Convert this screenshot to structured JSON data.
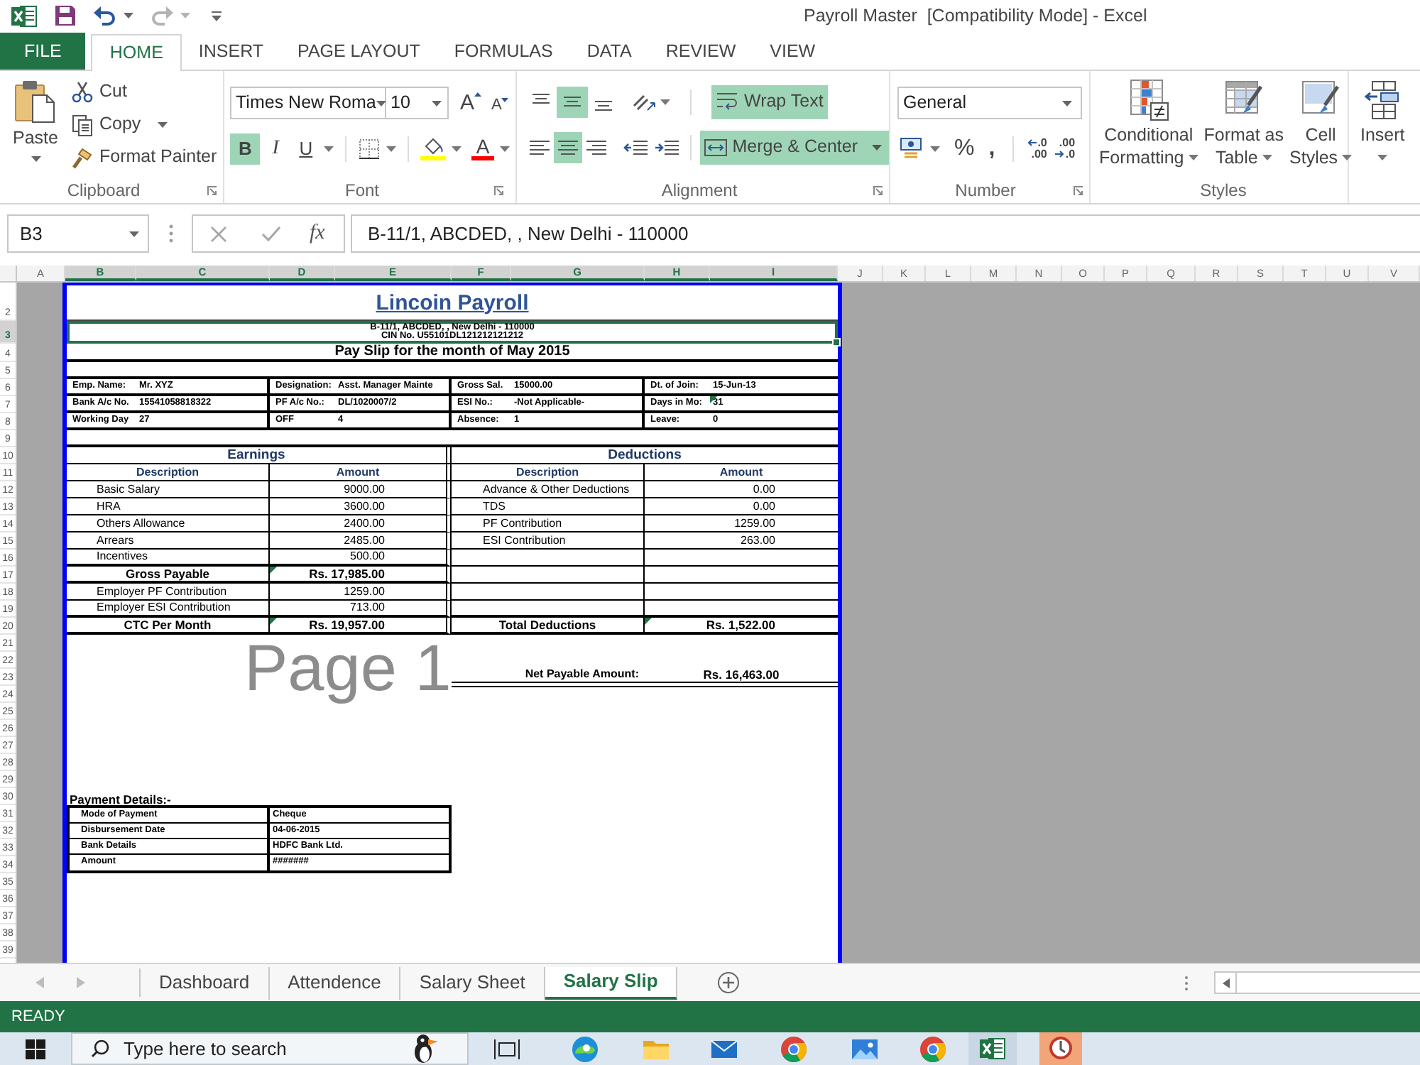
{
  "title_bar": {
    "title": "Payroll Master  [Compatibility Mode] - Excel"
  },
  "ribbon_tabs": [
    {
      "label": "FILE",
      "kind": "file",
      "selected": false
    },
    {
      "label": "HOME",
      "kind": "tab",
      "selected": true
    },
    {
      "label": "INSERT",
      "kind": "tab",
      "selected": false
    },
    {
      "label": "PAGE LAYOUT",
      "kind": "tab",
      "selected": false
    },
    {
      "label": "FORMULAS",
      "kind": "tab",
      "selected": false
    },
    {
      "label": "DATA",
      "kind": "tab",
      "selected": false
    },
    {
      "label": "REVIEW",
      "kind": "tab",
      "selected": false
    },
    {
      "label": "VIEW",
      "kind": "tab",
      "selected": false
    }
  ],
  "clipboard": {
    "paste": "Paste",
    "cut": "Cut",
    "copy": "Copy",
    "format_painter": "Format Painter",
    "group_label": "Clipboard"
  },
  "font": {
    "font_name": "Times New Roma",
    "font_size": "10",
    "grow_font": "A",
    "shrink_font": "A",
    "style_buttons": [
      {
        "label": "B",
        "on": true
      },
      {
        "label": "I",
        "on": false
      },
      {
        "label": "U",
        "on": false
      }
    ],
    "font_color": "A",
    "group_label": "Font"
  },
  "alignment": {
    "vertical": [
      {
        "kind": "top",
        "on": false
      },
      {
        "kind": "middle",
        "on": true
      },
      {
        "kind": "bottom",
        "on": false
      }
    ],
    "horizontal": [
      {
        "kind": "left",
        "on": false
      },
      {
        "kind": "center",
        "on": true
      },
      {
        "kind": "right",
        "on": false
      }
    ],
    "wrap_text": {
      "label": "Wrap Text",
      "on": true
    },
    "merge_center": {
      "label": "Merge & Center",
      "on": true
    },
    "group_label": "Alignment"
  },
  "number": {
    "format": "General",
    "percent": "%",
    "comma": ",",
    "decimal_buttons": [
      {
        "kind": "increase",
        "lines": [
          ".0",
          ".00"
        ]
      },
      {
        "kind": "decrease",
        "lines": [
          ".00",
          ".0"
        ]
      }
    ],
    "group_label": "Number"
  },
  "styles": {
    "buttons": [
      {
        "kind": "conditional",
        "lines": [
          "Conditional",
          "Formatting"
        ]
      },
      {
        "kind": "table",
        "lines": [
          "Format as",
          "Table"
        ]
      },
      {
        "kind": "cell",
        "lines": [
          "Cell",
          "Styles"
        ]
      }
    ],
    "group_label": "Styles"
  },
  "cells": {
    "insert": "Insert"
  },
  "formula_bar": {
    "name_box": "B3",
    "fx": "fx",
    "formula": "B-11/1, ABCDED, , New Delhi - 110000"
  },
  "columns": [
    {
      "label": "A",
      "selected": false
    },
    {
      "label": "B",
      "selected": true
    },
    {
      "label": "C",
      "selected": true
    },
    {
      "label": "D",
      "selected": true
    },
    {
      "label": "E",
      "selected": true
    },
    {
      "label": "F",
      "selected": true
    },
    {
      "label": "G",
      "selected": true
    },
    {
      "label": "H",
      "selected": true
    },
    {
      "label": "I",
      "selected": true
    },
    {
      "label": "J",
      "selected": false
    },
    {
      "label": "K",
      "selected": false
    },
    {
      "label": "L",
      "selected": false
    },
    {
      "label": "M",
      "selected": false
    },
    {
      "label": "N",
      "selected": false
    },
    {
      "label": "O",
      "selected": false
    },
    {
      "label": "P",
      "selected": false
    },
    {
      "label": "Q",
      "selected": false
    },
    {
      "label": "R",
      "selected": false
    },
    {
      "label": "S",
      "selected": false
    },
    {
      "label": "T",
      "selected": false
    },
    {
      "label": "U",
      "selected": false
    },
    {
      "label": "V",
      "selected": false
    }
  ],
  "rows": [
    {
      "label": "2",
      "selected": false
    },
    {
      "label": "3",
      "selected": true
    },
    {
      "label": "4",
      "selected": false
    },
    {
      "label": "5",
      "selected": false
    },
    {
      "label": "6",
      "selected": false
    },
    {
      "label": "7",
      "selected": false
    },
    {
      "label": "8",
      "selected": false
    },
    {
      "label": "9",
      "selected": false
    },
    {
      "label": "10",
      "selected": false
    },
    {
      "label": "11",
      "selected": false
    },
    {
      "label": "12",
      "selected": false
    },
    {
      "label": "13",
      "selected": false
    },
    {
      "label": "14",
      "selected": false
    },
    {
      "label": "15",
      "selected": false
    },
    {
      "label": "16",
      "selected": false
    },
    {
      "label": "17",
      "selected": false
    },
    {
      "label": "18",
      "selected": false
    },
    {
      "label": "19",
      "selected": false
    },
    {
      "label": "20",
      "selected": false
    },
    {
      "label": "21",
      "selected": false
    },
    {
      "label": "22",
      "selected": false
    },
    {
      "label": "23",
      "selected": false
    },
    {
      "label": "24",
      "selected": false
    },
    {
      "label": "25",
      "selected": false
    },
    {
      "label": "26",
      "selected": false
    },
    {
      "label": "27",
      "selected": false
    },
    {
      "label": "28",
      "selected": false
    },
    {
      "label": "29",
      "selected": false
    },
    {
      "label": "30",
      "selected": false
    },
    {
      "label": "31",
      "selected": false
    },
    {
      "label": "32",
      "selected": false
    },
    {
      "label": "33",
      "selected": false
    },
    {
      "label": "34",
      "selected": false
    },
    {
      "label": "35",
      "selected": false
    },
    {
      "label": "36",
      "selected": false
    },
    {
      "label": "37",
      "selected": false
    },
    {
      "label": "38",
      "selected": false
    },
    {
      "label": "39",
      "selected": false
    }
  ],
  "payslip": {
    "company": "Lincoin Payroll",
    "address": {
      "lines": [
        "B-11/1, ABCDED, , New Delhi - 110000",
        "CIN No. U55101DL121212121212"
      ],
      "selected": true
    },
    "heading": "Pay Slip for the month of May 2015",
    "info_rows": [
      [
        {
          "label": "Emp. Name:",
          "value": "Mr. XYZ",
          "flagged": false
        },
        {
          "label": "Designation:",
          "value": "Asst. Manager Mainte",
          "flagged": false
        },
        {
          "label": "Gross Sal.",
          "value": "15000.00",
          "flagged": false
        },
        {
          "label": "Dt. of Join:",
          "value": "15-Jun-13",
          "flagged": false
        }
      ],
      [
        {
          "label": "Bank A/c No.",
          "value": "15541058818322",
          "flagged": false
        },
        {
          "label": "PF A/c No.:",
          "value": "DL/1020007/2",
          "flagged": false
        },
        {
          "label": "ESI No.:",
          "value": "-Not Applicable-",
          "flagged": false
        },
        {
          "label": "Days in Mo:",
          "value": "31",
          "flagged": true
        }
      ],
      [
        {
          "label": "Working Day",
          "value": "27",
          "flagged": false
        },
        {
          "label": "OFF",
          "value": "4",
          "flagged": false
        },
        {
          "label": "Absence:",
          "value": "1",
          "flagged": false
        },
        {
          "label": "Leave:",
          "value": "0",
          "flagged": false
        }
      ]
    ],
    "earnings_title": "Earnings",
    "deductions_title": "Deductions",
    "column_headings": [
      "Description",
      "Amount",
      "Description",
      "Amount"
    ],
    "pay_rows": [
      {
        "kind": "item",
        "earning": {
          "description": "Basic Salary",
          "amount": "9000.00",
          "flagged": false
        },
        "deduction": {
          "description": "Advance & Other Deductions",
          "amount": "0.00",
          "flagged": false
        }
      },
      {
        "kind": "item",
        "earning": {
          "description": "HRA",
          "amount": "3600.00",
          "flagged": false
        },
        "deduction": {
          "description": "TDS",
          "amount": "0.00",
          "flagged": false
        }
      },
      {
        "kind": "item",
        "earning": {
          "description": "Others Allowance",
          "amount": "2400.00",
          "flagged": false
        },
        "deduction": {
          "description": "PF Contribution",
          "amount": "1259.00",
          "flagged": false
        }
      },
      {
        "kind": "item",
        "earning": {
          "description": "Arrears",
          "amount": "2485.00",
          "flagged": false
        },
        "deduction": {
          "description": "ESI Contribution",
          "amount": "263.00",
          "flagged": false
        }
      },
      {
        "kind": "item",
        "earning": {
          "description": "Incentives",
          "amount": "500.00",
          "flagged": false
        }
      },
      {
        "kind": "total",
        "earning": {
          "description": "Gross Payable",
          "amount": "Rs. 17,985.00",
          "flagged": true
        }
      },
      {
        "kind": "item",
        "earning": {
          "description": "Employer PF Contribution",
          "amount": "1259.00",
          "flagged": false
        }
      },
      {
        "kind": "item",
        "earning": {
          "description": "Employer ESI Contribution",
          "amount": "713.00",
          "flagged": false
        }
      },
      {
        "kind": "total",
        "earning": {
          "description": "CTC Per Month",
          "amount": "Rs. 19,957.00",
          "flagged": true
        },
        "deduction": {
          "description": "Total Deductions",
          "amount": "Rs. 1,522.00",
          "flagged": true
        }
      }
    ],
    "net_pay": {
      "label": "Net Payable Amount:",
      "amount": "Rs. 16,463.00"
    },
    "payment_title": "Payment Details:-",
    "payment_rows": [
      {
        "label": "Mode of Payment",
        "value": "Cheque"
      },
      {
        "label": "Disbursement Date",
        "value": "04-06-2015"
      },
      {
        "label": "Bank Details",
        "value": "HDFC Bank Ltd."
      },
      {
        "label": "Amount",
        "value": "#######"
      }
    ]
  },
  "page_label": "Page 1",
  "sheet_tabs": [
    {
      "label": "Dashboard",
      "selected": false
    },
    {
      "label": "Attendence",
      "selected": false
    },
    {
      "label": "Salary Sheet",
      "selected": false
    },
    {
      "label": "Salary Slip",
      "selected": true
    }
  ],
  "status_bar": {
    "status": "READY"
  },
  "taskbar": {
    "search": {
      "placeholder": "Type here to search"
    }
  }
}
